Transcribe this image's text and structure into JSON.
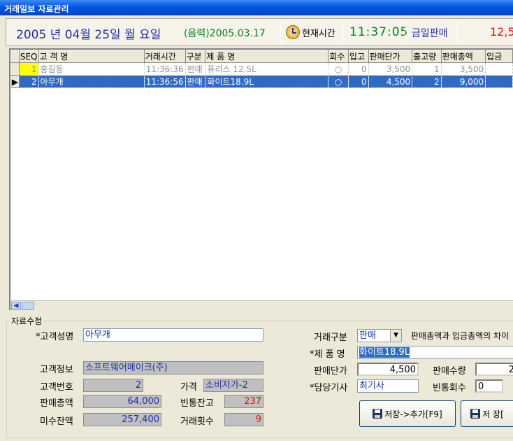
{
  "window": {
    "title": "거래일보 자료관리"
  },
  "header": {
    "date": "2005 년 04월 25일 월 요일",
    "lunar": "(음력)2005.03.17",
    "current_time_button": "현재시간",
    "time": "11:37:05",
    "today_sales_label": "금일판매",
    "today_sales_amount": "12,5"
  },
  "grid": {
    "columns": [
      "SEQ",
      "고 객 명",
      "거래시간",
      "구분",
      "제  품  명",
      "회수",
      "입고",
      "판매단가",
      "출고량",
      "판매총액",
      "입금"
    ],
    "rows": [
      {
        "indicator": "",
        "seq": "1",
        "customer": "홍길동",
        "time": "11:36:36",
        "type": "판매",
        "product": "퓨리스 12.5L",
        "collect": "○",
        "in": "0",
        "price": "3,500",
        "qty": "1",
        "total": "3,500",
        "deposit": ""
      },
      {
        "indicator": "▶",
        "seq": "2",
        "customer": "아무개",
        "time": "11:36:56",
        "type": "판매",
        "product": "화이트18.9L",
        "collect": "○",
        "in": "0",
        "price": "4,500",
        "qty": "2",
        "total": "9,000",
        "deposit": ""
      }
    ]
  },
  "edit": {
    "legend": "자료수정",
    "customer_name_label": "*고객성명",
    "customer_name": "아무개",
    "customer_info_label": "고객정보",
    "customer_info": "소프트웨어메이크(주)",
    "customer_no_label": "고객번호",
    "customer_no": "2",
    "price_label": "가격",
    "price_type": "소비자가-2",
    "sales_total_label": "판매총액",
    "sales_total": "64,000",
    "bottle_balance_label": "빈통잔고",
    "bottle_balance": "237",
    "unpaid_label": "미수잔액",
    "unpaid": "257,400",
    "trade_count_label": "거래횟수",
    "trade_count": "9",
    "trade_type_label": "거래구분",
    "trade_type": "판매",
    "notice": "판매총액과 입금총액의 차이",
    "product_label": "*제 품 명",
    "product": "화이트18.9L",
    "unit_price_label": "판매단가",
    "unit_price": "4,500",
    "sale_qty_label": "판매수량",
    "sale_qty": "2",
    "driver_label": "*담당기사",
    "driver": "최기사",
    "bottle_return_label": "빈통회수",
    "bottle_return": "0",
    "save_add_button": "저장->추가[F9]",
    "save_button": "저 장["
  }
}
